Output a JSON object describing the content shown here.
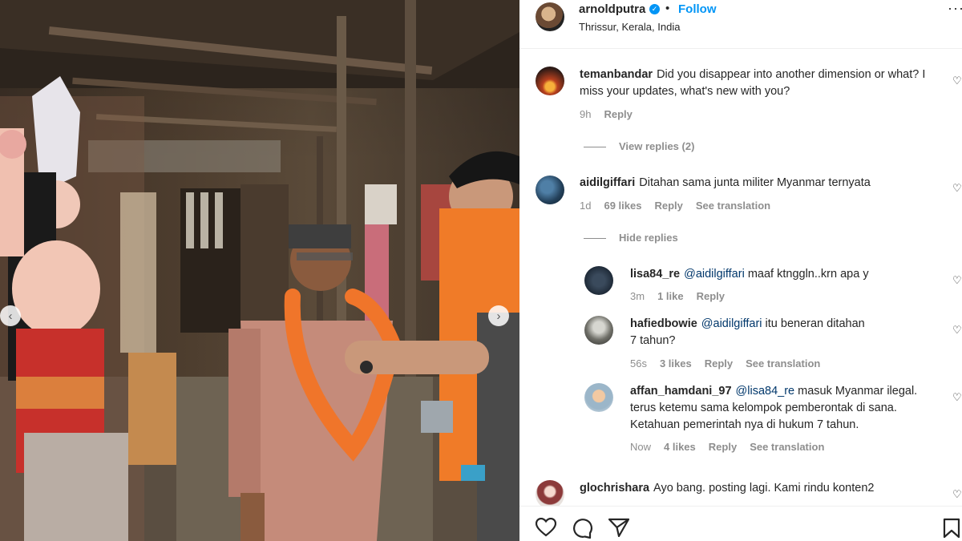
{
  "post": {
    "username": "arnoldputra",
    "follow_label": "Follow",
    "location": "Thrissur, Kerala, India",
    "dot": "•"
  },
  "comments": [
    {
      "username": "temanbandar",
      "text": "Did you disappear into another dimension or what? I miss your updates, what's new with you?",
      "time": "9h",
      "reply": "Reply",
      "view_replies": "View replies (2)"
    },
    {
      "username": "aidilgiffari",
      "text": "Ditahan sama junta militer Myanmar ternyata",
      "time": "1d",
      "likes": "69 likes",
      "reply": "Reply",
      "translation": "See translation",
      "hide_replies": "Hide replies",
      "replies": [
        {
          "username": "lisa84_re",
          "mention": "@aidilgiffari",
          "text": "maaf ktnggln..krn apa y",
          "time": "3m",
          "likes": "1 like",
          "reply": "Reply"
        },
        {
          "username": "hafiedbowie",
          "mention": "@aidilgiffari",
          "text": "itu beneran ditahan 7 tahun?",
          "time": "56s",
          "likes": "3 likes",
          "reply": "Reply",
          "translation": "See translation"
        },
        {
          "username": "affan_hamdani_97",
          "mention": "@lisa84_re",
          "text": "masuk Myanmar ilegal. terus ketemu sama kelompok pemberontak di sana. Ketahuan pemerintah nya di hukum 7 tahun.",
          "time": "Now",
          "likes": "4 likes",
          "reply": "Reply",
          "translation": "See translation"
        }
      ]
    },
    {
      "username": "glochrishara",
      "text": "Ayo bang. posting lagi. Kami rindu konten2"
    }
  ],
  "colors": {
    "link_blue": "#0095f6",
    "mention_blue": "#00376b",
    "meta_gray": "#8e8e8e"
  },
  "icons": {
    "like": "heart-icon",
    "comment": "comment-icon",
    "share": "share-icon",
    "save": "bookmark-icon",
    "more": "more-options-icon"
  }
}
